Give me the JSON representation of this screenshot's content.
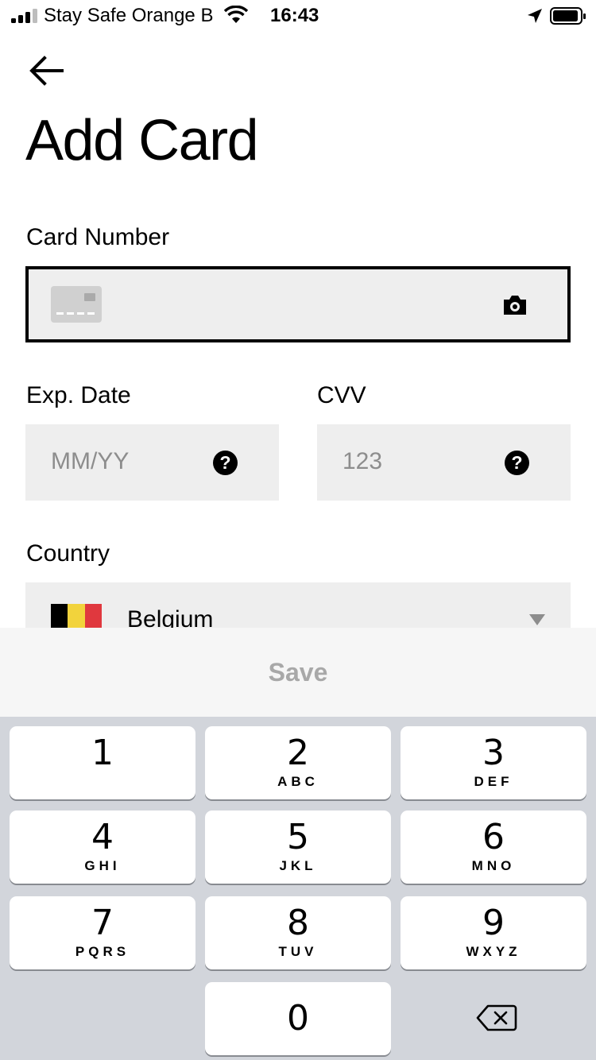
{
  "status_bar": {
    "carrier": "Stay Safe Orange B",
    "time": "16:43"
  },
  "header": {
    "back_icon": "arrow-left-icon",
    "title": "Add Card"
  },
  "form": {
    "card_number": {
      "label": "Card Number",
      "value": "",
      "card_icon": "credit-card-icon",
      "scan_icon": "camera-icon"
    },
    "exp_date": {
      "label": "Exp. Date",
      "placeholder": "MM/YY",
      "help_glyph": "?"
    },
    "cvv": {
      "label": "CVV",
      "placeholder": "123",
      "help_glyph": "?"
    },
    "country": {
      "label": "Country",
      "selected": "Belgium",
      "flag_colors": [
        "#000000",
        "#f2d33c",
        "#e0383e"
      ]
    }
  },
  "save_label": "Save",
  "keypad": {
    "keys": [
      {
        "num": "1",
        "letters": ""
      },
      {
        "num": "2",
        "letters": "ABC"
      },
      {
        "num": "3",
        "letters": "DEF"
      },
      {
        "num": "4",
        "letters": "GHI"
      },
      {
        "num": "5",
        "letters": "JKL"
      },
      {
        "num": "6",
        "letters": "MNO"
      },
      {
        "num": "7",
        "letters": "PQRS"
      },
      {
        "num": "8",
        "letters": "TUV"
      },
      {
        "num": "9",
        "letters": "WXYZ"
      },
      {
        "num": "0",
        "letters": ""
      }
    ],
    "delete_icon": "backspace-icon"
  },
  "colors": {
    "field_bg": "#eeeeee",
    "keypad_bg": "#d2d5db",
    "disabled_text": "#a8a8a8"
  }
}
